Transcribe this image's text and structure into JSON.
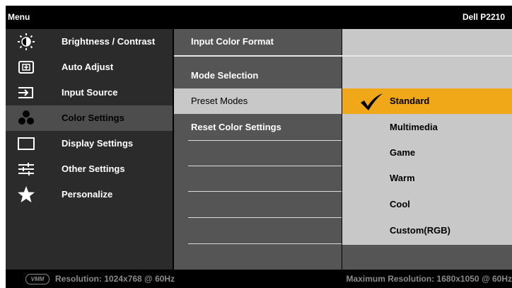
{
  "header": {
    "menu_title": "Menu",
    "model": "Dell P2210"
  },
  "left_menu": [
    {
      "label": "Brightness / Contrast",
      "icon": "brightness-icon"
    },
    {
      "label": "Auto Adjust",
      "icon": "auto-adjust-icon"
    },
    {
      "label": "Input Source",
      "icon": "input-source-icon"
    },
    {
      "label": "Color Settings",
      "icon": "color-settings-icon",
      "selected": true
    },
    {
      "label": "Display Settings",
      "icon": "display-settings-icon"
    },
    {
      "label": "Other Settings",
      "icon": "other-settings-icon"
    },
    {
      "label": "Personalize",
      "icon": "star-icon"
    }
  ],
  "mid_menu": [
    {
      "label": "Input Color Format"
    },
    {
      "label": "Mode Selection"
    },
    {
      "label": "Preset Modes",
      "selected": true
    },
    {
      "label": "Reset Color Settings"
    }
  ],
  "preset_options": [
    {
      "label": "Standard",
      "selected": true
    },
    {
      "label": "Multimedia"
    },
    {
      "label": "Game"
    },
    {
      "label": "Warm"
    },
    {
      "label": "Cool"
    },
    {
      "label": "Custom(RGB)"
    }
  ],
  "footer": {
    "vmm_badge": "VMM",
    "resolution": "Resolution: 1024x768 @ 60Hz",
    "max_resolution": "Maximum Resolution: 1680x1050 @ 60Hz"
  },
  "colors": {
    "highlight": "#f0a818",
    "selected_left": "#4d4d4d",
    "panel_right": "#c8c8c8"
  }
}
